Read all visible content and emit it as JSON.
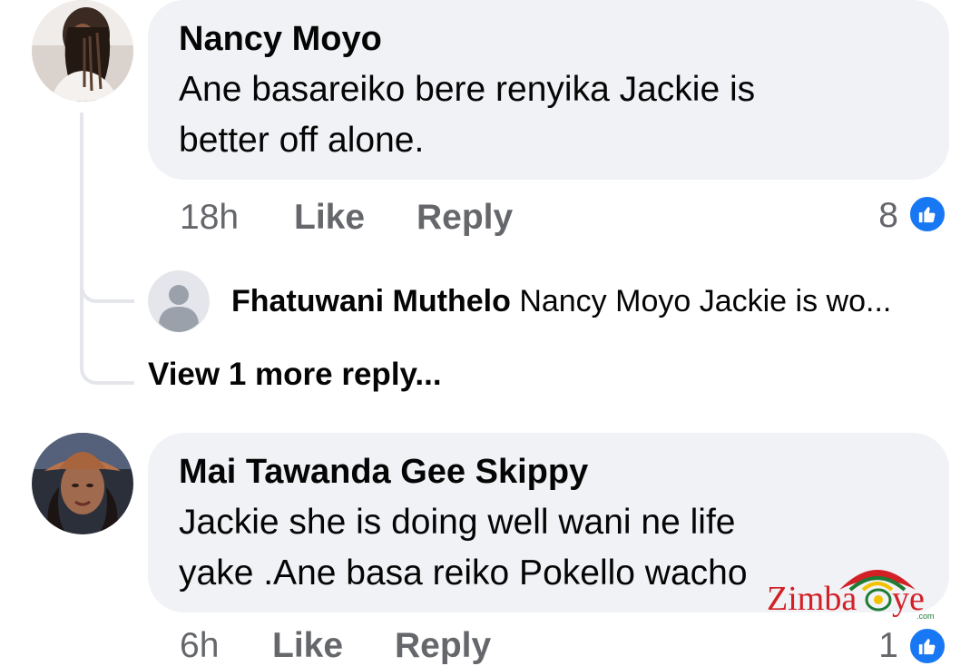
{
  "comments": [
    {
      "author": "Nancy Moyo",
      "text": "Ane basareiko bere renyika Jackie is\nbetter off alone.",
      "time": "18h",
      "like_label": "Like",
      "reply_label": "Reply",
      "reaction_count": "8",
      "reaction_icon": "thumbs-up-icon",
      "replies": [
        {
          "author": "Fhatuwani Muthelo",
          "snippet": "Nancy Moyo Jackie is wo..."
        }
      ],
      "view_more_label": "View 1 more reply..."
    },
    {
      "author": "Mai Tawanda Gee Skippy",
      "text": "Jackie she is doing well wani ne life\nyake .Ane basa reiko Pokello wacho",
      "time": "6h",
      "like_label": "Like",
      "reply_label": "Reply",
      "reaction_count": "1",
      "reaction_icon": "thumbs-up-icon"
    }
  ],
  "watermark": {
    "left": "Zimba",
    "right": "ye",
    "sub": ".com"
  },
  "colors": {
    "bubble_bg": "#f0f2f5",
    "meta_text": "#65676b",
    "like_blue": "#1877f2",
    "thread_line": "#e4e6eb",
    "watermark_red": "#d32027",
    "watermark_green": "#1e7b34"
  }
}
